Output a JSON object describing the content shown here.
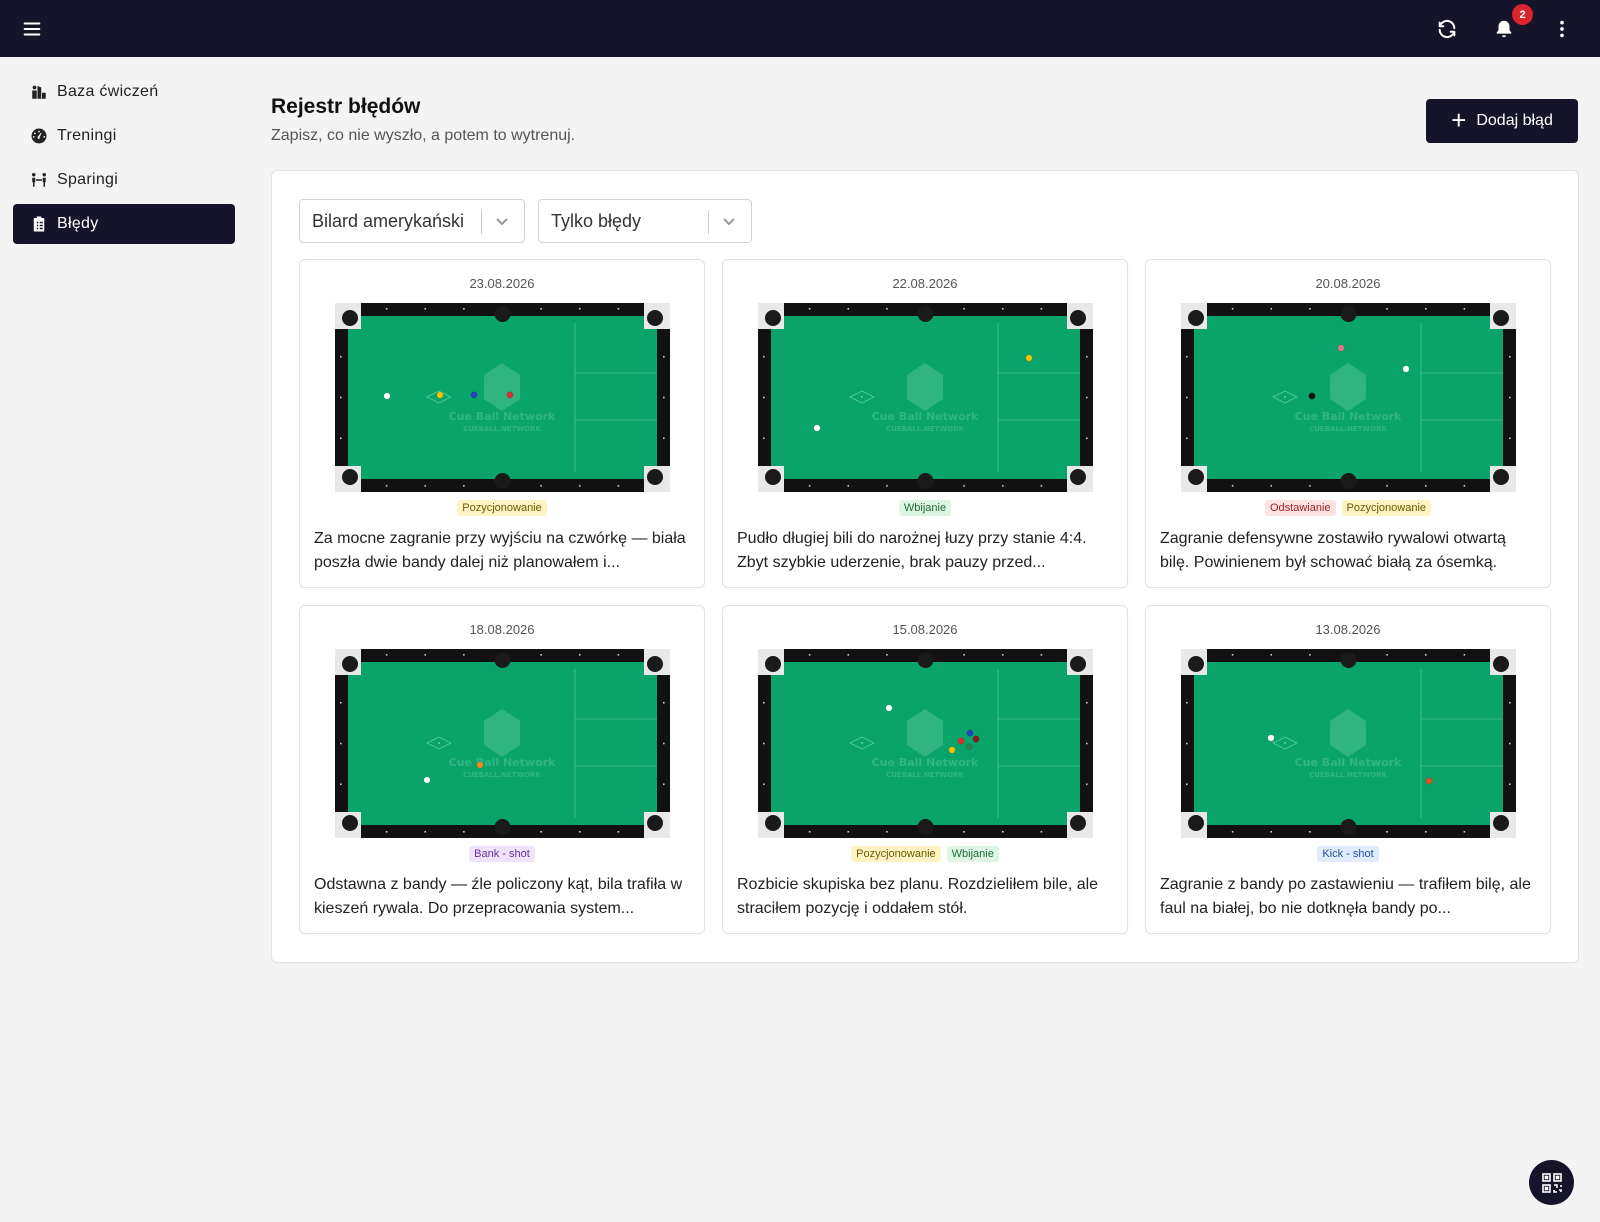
{
  "topbar": {
    "menu_icon": "hamburger-icon",
    "refresh_icon": "refresh-icon",
    "bell_icon": "bell-icon",
    "notification_count": "2",
    "more_icon": "more-vertical-icon",
    "background": "#15142b"
  },
  "sidebar": {
    "items": [
      {
        "label": "Baza ćwiczeń",
        "icon": "exercise-base-icon",
        "active": false
      },
      {
        "label": "Treningi",
        "icon": "gauge-icon",
        "active": false
      },
      {
        "label": "Sparingi",
        "icon": "sparring-icon",
        "active": false
      },
      {
        "label": "Błędy",
        "icon": "clipboard-icon",
        "active": true
      }
    ]
  },
  "header": {
    "title": "Rejestr błędów",
    "subtitle": "Zapisz, co nie wyszło, a potem to wytrenuj.",
    "add_button": "Dodaj błąd"
  },
  "filters": {
    "game": "Bilard amerykański",
    "type": "Tylko błędy"
  },
  "table_watermark": {
    "line1": "Cue Ball Network",
    "line2": "CUEBALL.NETWORK"
  },
  "cards": [
    {
      "date": "23.08.2026",
      "tags": [
        {
          "label": "Pozycjonowanie",
          "kind": "pos"
        }
      ],
      "description": "Za mocne zagranie przy wyjściu na czwórkę — biała poszła dwie bandy dalej niż planowałem i..."
    },
    {
      "date": "22.08.2026",
      "tags": [
        {
          "label": "Wbijanie",
          "kind": "wbi"
        }
      ],
      "description": "Pudło długiej bili do narożnej łuzy przy stanie 4:4. Zbyt szybkie uderzenie, brak pauzy przed..."
    },
    {
      "date": "20.08.2026",
      "tags": [
        {
          "label": "Odstawianie",
          "kind": "ods"
        },
        {
          "label": "Pozycjonowanie",
          "kind": "pos"
        }
      ],
      "description": "Zagranie defensywne zostawiło rywalowi otwartą bilę. Powinienem był schować białą za ósemką."
    },
    {
      "date": "18.08.2026",
      "tags": [
        {
          "label": "Bank - shot",
          "kind": "bank"
        }
      ],
      "description": "Odstawna z bandy — źle policzony kąt, bila trafiła w kieszeń rywala. Do przepracowania system..."
    },
    {
      "date": "15.08.2026",
      "tags": [
        {
          "label": "Pozycjonowanie",
          "kind": "pos"
        },
        {
          "label": "Wbijanie",
          "kind": "wbi"
        }
      ],
      "description": "Rozbicie skupiska bez planu. Rozdzieliłem bile, ale straciłem pozycję i oddałem stół."
    },
    {
      "date": "13.08.2026",
      "tags": [
        {
          "label": "Kick - shot",
          "kind": "kick"
        }
      ],
      "description": "Zagranie z bandy po zastawieniu — trafiłem bilę, ale faul na białej, bo nie dotknęła bandy po..."
    }
  ],
  "qr_icon": "qr-code-icon",
  "colors": {
    "felt": "#0aa36a",
    "rail": "#111111",
    "accent_dark": "#15142b",
    "badge": "#d9252b"
  }
}
